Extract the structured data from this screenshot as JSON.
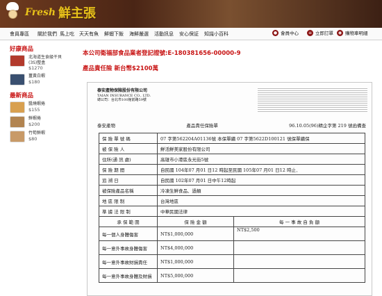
{
  "header": {
    "brand_en": "Fresh",
    "brand_cn": "鮮主張"
  },
  "nav": [
    "會員專區",
    "關於我們",
    "馬上吃",
    "天天有魚",
    "鮮蝦下飯",
    "海鮮嚴選",
    "活動訊息",
    "安心保証",
    "知識小百科"
  ],
  "utility": [
    {
      "label": "會員中心",
      "icon": "user-icon"
    },
    {
      "label": "立即訂單",
      "icon": "list-icon"
    },
    {
      "label": "購物車明細",
      "icon": "cart-icon"
    }
  ],
  "sidebar": {
    "hot_title": "好康商品",
    "hot": [
      {
        "name": "北海道生食級干貝(3S)整盒",
        "price": "$1270",
        "color": "#b23a2c"
      },
      {
        "name": "薑黃白蝦",
        "price": "$180",
        "color": "#3a5070"
      }
    ],
    "new_title": "最新商品",
    "new": [
      {
        "name": "醬燒蝦捲",
        "price": "$155",
        "color": "#d8a050"
      },
      {
        "name": "鮮蝦捲",
        "price": "$200",
        "color": "#b28450"
      },
      {
        "name": "竹筍鮮蝦",
        "price": "$80",
        "color": "#c89a68"
      }
    ]
  },
  "main": {
    "cert": "本公司衛福部食品業者登記證號:E-180381656-00000-9",
    "insurance": "產品責任險 新台幣$2100萬"
  },
  "doc": {
    "company": "泰安產物保險股份有限公司",
    "company_en": "TAIAN INSURANCE CO., LTD.",
    "addr": "總公司：台北市100館前路59號",
    "head_left": "泰安產物",
    "head_mid": "產品責任保險單",
    "head_right": "96.10.05(96)精企字第 219 號函備查",
    "rows": [
      {
        "k": "保 險 單 號 碼",
        "v": "07 字第562204A01136號   本保單續 07 字第5622D100121 號保單續保"
      },
      {
        "k": "被 保 險 人",
        "v": "鮮活鮮美家股份有限公司"
      },
      {
        "k": "住所(通 訊 處)",
        "v": "高雄市小港區永光街5號"
      },
      {
        "k": "保 險 期 間",
        "v": "自民國 104年07 月01 日12 時起至民國 105年07 月01 日12 時止．"
      },
      {
        "k": "追 溯 日",
        "v": "自民國 102年07 月01 日中午12時起"
      },
      {
        "k": "被保險產品名稱",
        "v": "冷凍生鮮食品、過類"
      },
      {
        "k": "地 區 限 制",
        "v": "台灣地區"
      },
      {
        "k": "準 據 法 限 制",
        "v": "中華民國法律"
      }
    ],
    "cov_head": [
      "承 保 範 圍",
      "保 險 金 額",
      "每 一 事 故 自 負 額"
    ],
    "cov": [
      {
        "k": "每一個人身體傷害",
        "v": "NT$1,000,000",
        "d": "NT$2,500"
      },
      {
        "k": "每一意外事故身體傷害",
        "v": "NT$4,000,000",
        "d": ""
      },
      {
        "k": "每一意外事故財損責任",
        "v": "NT$1,000,000",
        "d": ""
      },
      {
        "k": "每一意外事故身體及財損",
        "v": "NT$5,000,000",
        "d": ""
      }
    ]
  }
}
